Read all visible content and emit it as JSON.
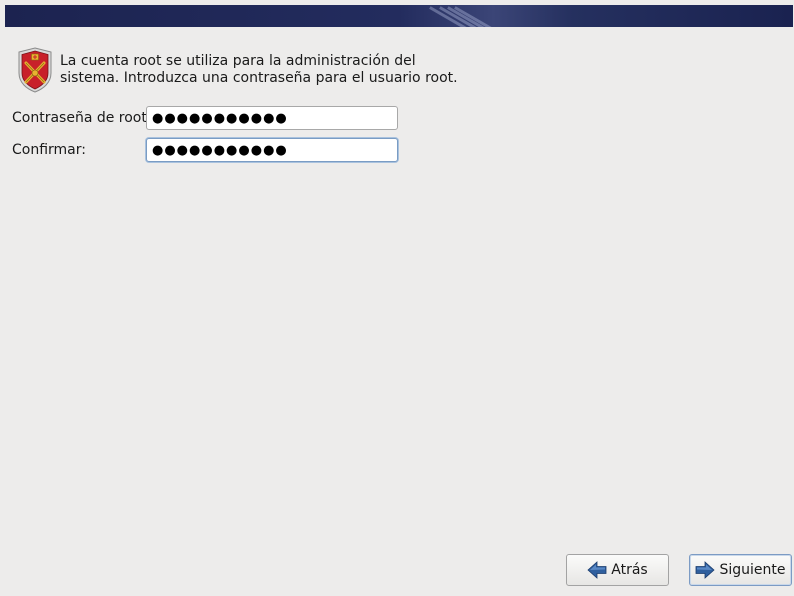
{
  "intro": {
    "line1": "La cuenta root se utiliza para la administración del",
    "line2": "sistema. Introduzca una contraseña para el usuario root."
  },
  "fields": {
    "root_password_label": "Contraseña de root:",
    "root_password_value": "●●●●●●●●●●●",
    "confirm_label": "Confirmar:",
    "confirm_value": "●●●●●●●●●●●"
  },
  "buttons": {
    "back_label": "Atrás",
    "next_label": "Siguiente"
  },
  "icons": {
    "shield": "shield-icon",
    "back": "arrow-left-icon",
    "next": "arrow-right-icon"
  },
  "colors": {
    "banner": "#1c2350",
    "background": "#edeceb",
    "arrow_blue": "#2f5f9e",
    "shield_red": "#c8202a",
    "shield_gold": "#e8b430"
  }
}
